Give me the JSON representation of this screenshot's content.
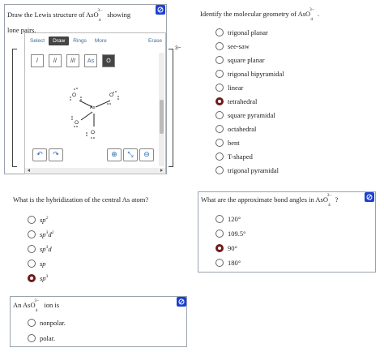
{
  "lewis": {
    "prompt_pre": "Draw the Lewis structure of AsO",
    "ion_sub": "4",
    "ion_sup": "3−",
    "prompt_post": " showing",
    "prompt_line2": "lone pairs.",
    "tabs": [
      "Select",
      "Draw",
      "Rings",
      "More"
    ],
    "active_tab": "Draw",
    "erase": "Erase",
    "tools": [
      "/",
      "//",
      "///",
      "As",
      "O"
    ],
    "charge": "3−",
    "atoms": {
      "center": "As",
      "top_left": "O",
      "top_right": "O",
      "left": "O",
      "bottom": "O"
    }
  },
  "geometry": {
    "question_pre": "Identify the molecular geometry of AsO",
    "ion_sub": "4",
    "ion_sup": "3−",
    "question_post": ".",
    "options": [
      "trigonal planar",
      "see-saw",
      "square planar",
      "trigonal bipyramidal",
      "linear",
      "tetrahedral",
      "square pyramidal",
      "octahedral",
      "bent",
      "T-shaped",
      "trigonal pyramidal"
    ],
    "selected": "tetrahedral"
  },
  "hybrid": {
    "question": "What is the hybridization of the central As atom?",
    "options": [
      {
        "base": "sp",
        "sup": "2",
        "sup2": "",
        "tail": ""
      },
      {
        "base": "sp",
        "sup": "3",
        "sup2": "2",
        "tail": "d"
      },
      {
        "base": "sp",
        "sup": "3",
        "sup2": "",
        "tail": "d"
      },
      {
        "base": "sp",
        "sup": "",
        "sup2": "",
        "tail": ""
      },
      {
        "base": "sp",
        "sup": "3",
        "sup2": "",
        "tail": ""
      }
    ],
    "selected_index": 4
  },
  "angles": {
    "question_pre": "What are the approximate bond angles in AsO",
    "ion_sub": "4",
    "ion_sup": "3−",
    "question_post": "?",
    "options": [
      "120°",
      "109.5°",
      "90°",
      "180°"
    ],
    "selected": "90°"
  },
  "polarity": {
    "question_pre": "An AsO",
    "ion_sub": "4",
    "ion_sup": "3−",
    "question_post": " ion is",
    "options": [
      "nonpolar.",
      "polar."
    ]
  },
  "colors": {
    "accent": "#1e40d0",
    "selected_radio": "#6e1a1a",
    "tab_link": "#3a6b9a"
  }
}
